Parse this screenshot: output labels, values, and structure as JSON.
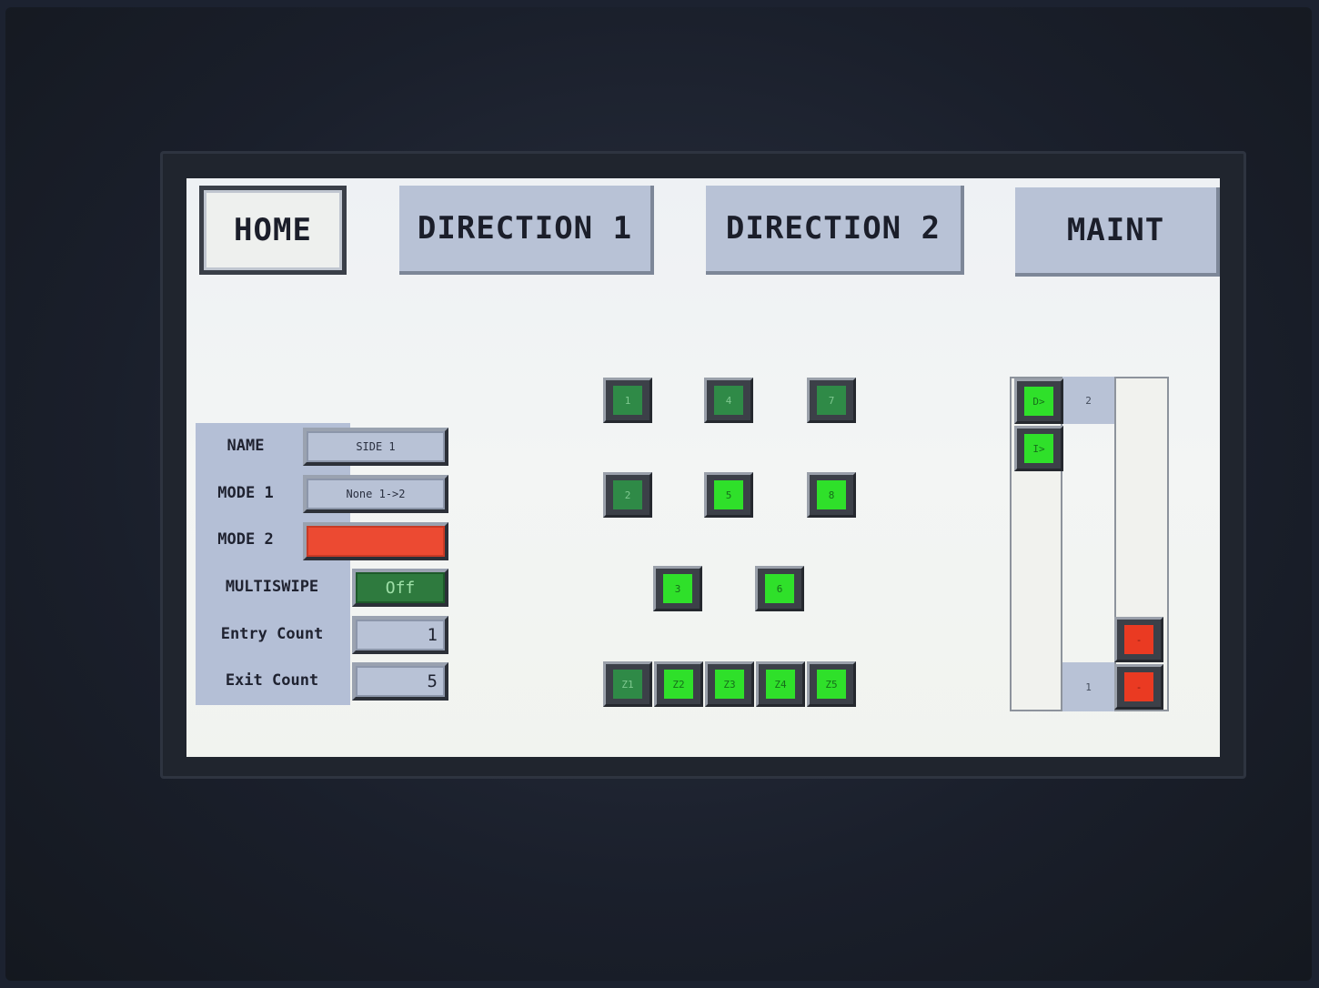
{
  "nav": {
    "home": "HOME",
    "direction1": "DIRECTION 1",
    "direction2": "DIRECTION 2",
    "maint": "MAINT"
  },
  "settings": {
    "name_label": "NAME",
    "name_value": "SIDE 1",
    "mode1_label": "MODE 1",
    "mode1_value": "None 1->2",
    "mode2_label": "MODE 2",
    "mode2_value": "",
    "multiswipe_label": "MULTISWIPE",
    "multiswipe_value": "Off",
    "entry_count_label": "Entry Count",
    "entry_count_value": "1",
    "exit_count_label": "Exit Count",
    "exit_count_value": "5"
  },
  "lamps": {
    "l1": "1",
    "l2": "2",
    "l3": "3",
    "l4": "4",
    "l5": "5",
    "l6": "6",
    "l7": "7",
    "l8": "8",
    "z1": "Z1",
    "z2": "Z2",
    "z3": "Z3",
    "z4": "Z4",
    "z5": "Z5"
  },
  "right_panel": {
    "top_btn1": "D>",
    "top_btn2": "I>",
    "tag_top": "2",
    "tag_bottom": "1",
    "red_btn1": "-",
    "red_btn2": "-"
  },
  "colors": {
    "panel_blue": "#b8c2d6",
    "lamp_on": "#2fe02a",
    "lamp_dim": "#2f8a47",
    "alarm_red": "#ec4a32"
  }
}
